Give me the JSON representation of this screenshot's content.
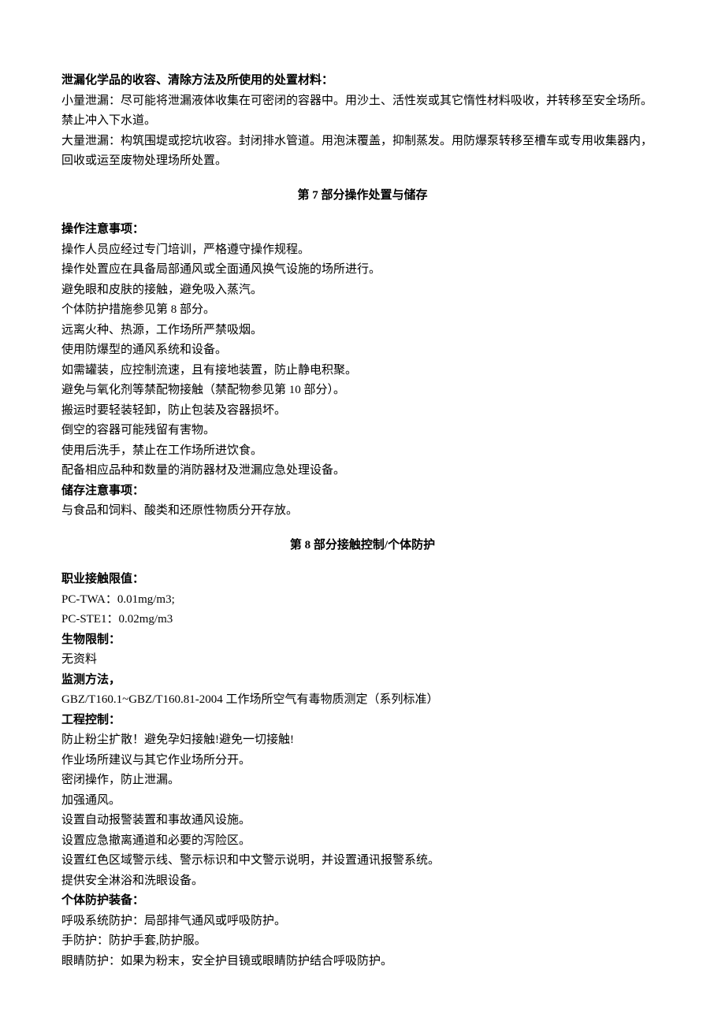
{
  "s6": {
    "h1": "泄漏化学品的收容、清除方法及所使用的处置材料：",
    "p1": "小量泄漏：尽可能将泄漏液体收集在可密闭的容器中。用沙土、活性炭或其它惰性材料吸收，并转移至安全场所。禁止冲入下水道。",
    "p2": "大量泄漏：构筑围堤或挖坑收容。封闭排水管道。用泡沫覆盖，抑制蒸发。用防爆泵转移至槽车或专用收集器内，回收或运至废物处理场所处置。"
  },
  "s7": {
    "header": "第 7 部分操作处置与储存",
    "opHeading": "操作注意事项：",
    "op": [
      "操作人员应经过专门培训，严格遵守操作规程。",
      "操作处置应在具备局部通风或全面通风换气设施的场所进行。",
      "避免眼和皮肤的接触，避免吸入蒸汽。",
      "个体防护措施参见第 8 部分。",
      "远离火种、热源，工作场所严禁吸烟。",
      "使用防爆型的通风系统和设备。",
      "如需罐装，应控制流速，且有接地装置，防止静电积聚。",
      "避免与氧化剂等禁配物接触（禁配物参见第 10 部分）。",
      "搬运时要轻装轻卸，防止包装及容器损坏。",
      "倒空的容器可能残留有害物。",
      "使用后洗手，禁止在工作场所进饮食。",
      "配备相应品种和数量的消防器材及泄漏应急处理设备。"
    ],
    "storeHeading": "储存注意事项：",
    "store1": "与食品和饲料、酸类和还原性物质分开存放。"
  },
  "s8": {
    "header": "第 8 部分接触控制/个体防护",
    "oelHeading": "职业接触限值：",
    "oel1": "PC-TWA：0.01mg/m3;",
    "oel2": "PC-STE1：0.02mg/m3",
    "bioHeading": "生物限制：",
    "bio1": "无资料",
    "monHeading": "监测方法，",
    "mon1": "GBZ/T160.1~GBZ/T160.81-2004 工作场所空气有毒物质测定（系列标准）",
    "engHeading": "工程控制：",
    "eng": [
      "防止粉尘扩散！避免孕妇接触!避免一切接触!",
      "作业场所建议与其它作业场所分开。",
      "密闭操作，防止泄漏。",
      "加强通风。",
      "设置自动报警装置和事故通风设施。",
      "设置应急撤离通道和必要的泻险区。",
      "设置红色区域警示线、警示标识和中文警示说明，并设置通讯报警系统。",
      "提供安全淋浴和洗眼设备。"
    ],
    "ppeHeading": "个体防护装备：",
    "ppe": [
      "呼吸系统防护：局部排气通风或呼吸防护。",
      "手防护：防护手套,防护服。",
      "眼睛防护：如果为粉末，安全护目镜或眼睛防护结合呼吸防护。"
    ]
  }
}
